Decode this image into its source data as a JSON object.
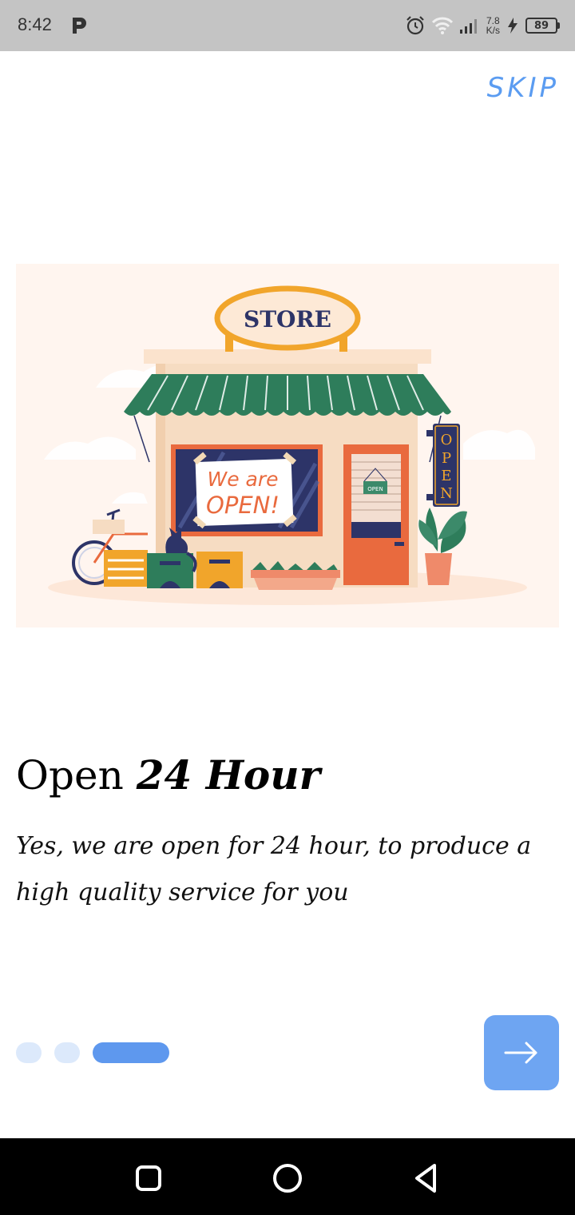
{
  "status": {
    "time": "8:42",
    "speed_value": "7.8",
    "speed_unit": "K/s",
    "battery": "89",
    "icons": [
      "p-app-icon",
      "alarm-icon",
      "wifi-icon",
      "signal-icon",
      "charging-icon",
      "battery-icon"
    ]
  },
  "header": {
    "skip_label": "SKIP"
  },
  "illustration": {
    "store_sign": "STORE",
    "window_sign_line1": "We are",
    "window_sign_line2": "OPEN!",
    "door_sign": "OPEN",
    "vertical_sign": [
      "O",
      "P",
      "E",
      "N"
    ]
  },
  "content": {
    "title_light": "Open",
    "title_bold": "24 Hour",
    "description": "Yes, we are open for 24 hour, to produce a high quality service for you"
  },
  "pagination": {
    "total": 3,
    "active": 3
  },
  "colors": {
    "accent": "#5b9cf1",
    "button": "#6ea5f2",
    "dot_inactive": "#dce9fb",
    "dot_active": "#5e98ee",
    "awning": "#2e7d5b",
    "store_outline": "#f1a52b",
    "door": "#e96a3e",
    "navy": "#2d3468"
  },
  "navigation": {
    "buttons": [
      "recents-button",
      "home-button",
      "back-button"
    ]
  }
}
